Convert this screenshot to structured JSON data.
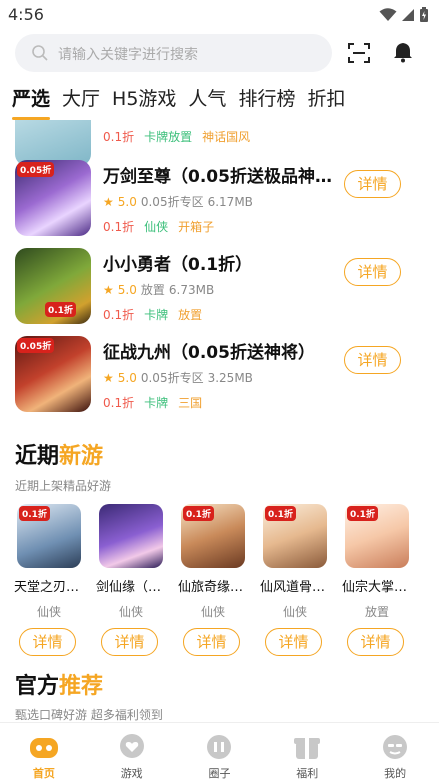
{
  "status": {
    "time": "4:56"
  },
  "search": {
    "placeholder": "请输入关键字进行搜索"
  },
  "tabs": [
    "严选",
    "大厅",
    "H5游戏",
    "人气",
    "排行榜",
    "折扣"
  ],
  "partial_row": {
    "tags": [
      "0.1折",
      "卡牌放置",
      "神话国风"
    ]
  },
  "games": [
    {
      "title": "万剑至尊（0.05折送极品神兵…",
      "score": "5.0",
      "zone": "0.05折专区",
      "size": "6.17MB",
      "tags": [
        "0.1折",
        "仙侠",
        "开箱子"
      ],
      "badge": "0.05折",
      "btn": "详情"
    },
    {
      "title": "小小勇者（0.1折）",
      "score": "5.0",
      "zone": "放置",
      "size": "6.73MB",
      "tags": [
        "0.1折",
        "卡牌",
        "放置"
      ],
      "badge": "0.1折",
      "btn": "详情"
    },
    {
      "title": "征战九州（0.05折送神将）",
      "score": "5.0",
      "zone": "0.05折专区",
      "size": "3.25MB",
      "tags": [
        "0.1折",
        "卡牌",
        "三国"
      ],
      "badge": "0.05折",
      "btn": "详情"
    }
  ],
  "new_section": {
    "title_a": "近期",
    "title_b": "新游",
    "subtitle": "近期上架精品好游"
  },
  "new_games": [
    {
      "name": "天堂之刃…",
      "cat": "仙侠",
      "btn": "详情",
      "badge": "0.1折"
    },
    {
      "name": "剑仙缘（…",
      "cat": "仙侠",
      "btn": "详情",
      "badge": ""
    },
    {
      "name": "仙旅奇缘…",
      "cat": "仙侠",
      "btn": "详情",
      "badge": "0.1折"
    },
    {
      "name": "仙风道骨…",
      "cat": "仙侠",
      "btn": "详情",
      "badge": "0.1折"
    },
    {
      "name": "仙宗大掌…",
      "cat": "放置",
      "btn": "详情",
      "badge": "0.1折"
    }
  ],
  "official_section": {
    "title_a": "官方",
    "title_b": "推荐",
    "subtitle": "甄选口碑好游 超多福利领到"
  },
  "nav": [
    {
      "label": "首页",
      "icon": "home-gamepad-icon"
    },
    {
      "label": "游戏",
      "icon": "heart-bubble-icon"
    },
    {
      "label": "圈子",
      "icon": "circle-chat-icon"
    },
    {
      "label": "福利",
      "icon": "gift-icon"
    },
    {
      "label": "我的",
      "icon": "user-avatar-icon"
    }
  ],
  "colors": {
    "accent": "#f5a623",
    "red": "#ef5a4c",
    "green": "#3bbf7a"
  }
}
